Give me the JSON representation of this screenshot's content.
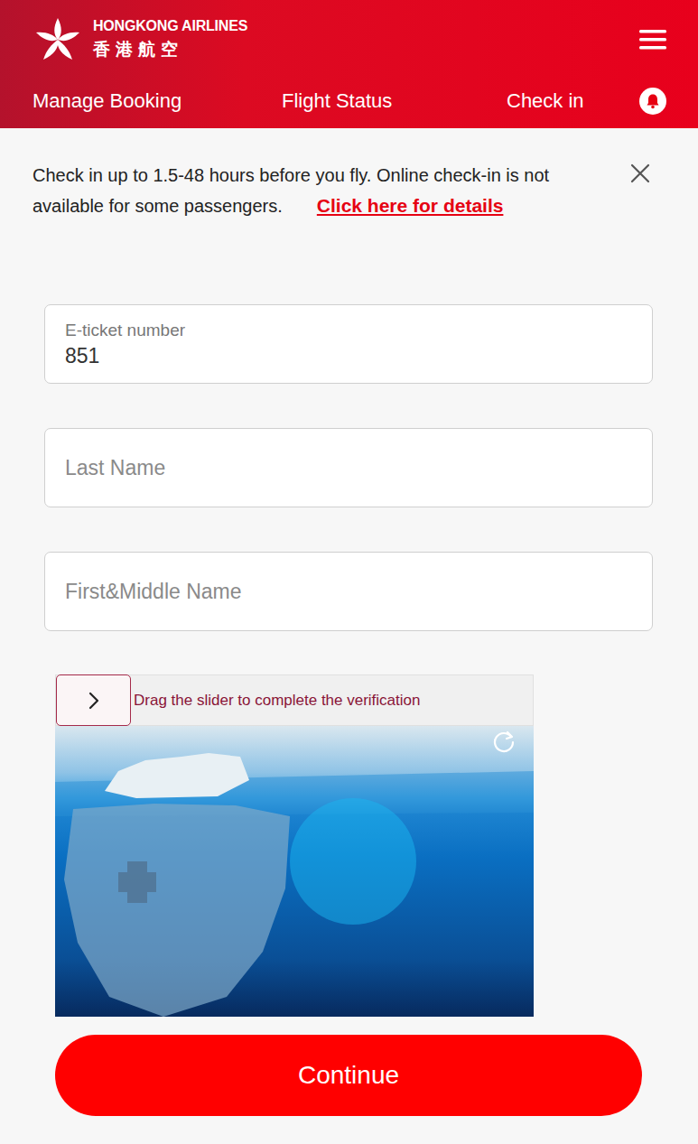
{
  "header": {
    "brand": "HONGKONG AIRLINES",
    "brand_chinese": "香港航空"
  },
  "nav": [
    {
      "label": "Manage Booking",
      "selected": false
    },
    {
      "label": "Flight Status",
      "selected": false
    },
    {
      "label": "Check in",
      "selected": true
    }
  ],
  "notice": {
    "text": "Check in up to 1.5-48 hours before you fly. Online check-in is not available for some passengers.",
    "link": "Click here for details"
  },
  "form": {
    "fields": [
      {
        "kind": "filled",
        "label": "E-ticket number",
        "value": "851"
      },
      {
        "kind": "empty",
        "placeholder": "Last Name"
      },
      {
        "kind": "empty",
        "placeholder": "First&Middle Name"
      }
    ]
  },
  "captcha": {
    "instruction": "Drag the slider to complete the verification",
    "level": 0
  },
  "continue_button": "Continue"
}
